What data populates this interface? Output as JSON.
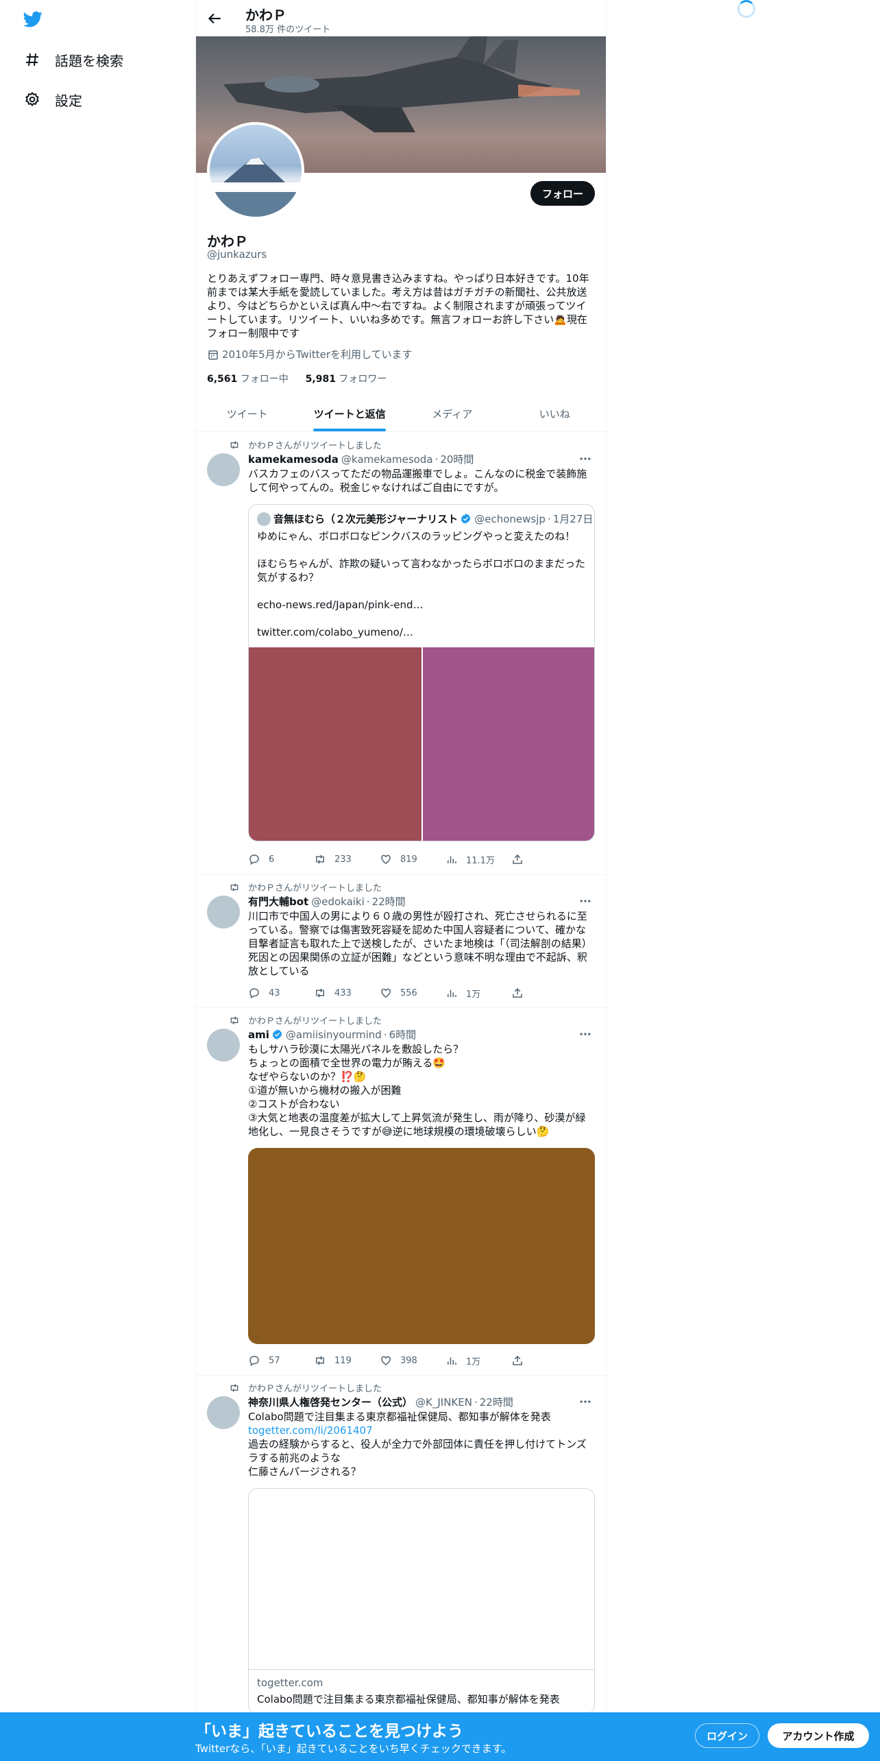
{
  "colors": {
    "accent": "#1d9bf0",
    "text": "#0f1419",
    "secondary": "#536471",
    "verified": "#1d9bf0"
  },
  "nav": {
    "logo_icon": "twitter-bird-icon",
    "explore_label": "話題を検索",
    "settings_label": "設定"
  },
  "header": {
    "title": "かわＰ",
    "subtitle": "58.8万 件のツイート"
  },
  "profile": {
    "name": "かわＰ",
    "handle": "@junkazurs",
    "follow_label": "フォロー",
    "bio": "とりあえずフォロー専門、時々意見書き込みますね。やっぱり日本好きです。10年前までは某大手紙を愛読していました。考え方は昔はガチガチの新聞社、公共放送より、今はどちらかといえば真ん中～右ですね。よく制限されますが頑張ってツイートしています。リツイート、いいね多めです。無言フォローお許し下さい🙇現在フォロー制限中です",
    "joined": "2010年5月からTwitterを利用しています",
    "following_count": "6,561",
    "following_label": "フォロー中",
    "followers_count": "5,981",
    "followers_label": "フォロワー"
  },
  "tabs": [
    {
      "label": "ツイート"
    },
    {
      "label": "ツイートと返信"
    },
    {
      "label": "メディア"
    },
    {
      "label": "いいね"
    }
  ],
  "tweets": [
    {
      "retweet_label": "かわＰさんがリツイートしました",
      "name": "kamekamesoda",
      "handle": "@kamekamesoda",
      "time": "20時間",
      "text": "バスカフェのバスってただの物品運搬車でしょ。こんなのに税金で装飾施して何やってんの。税金じゃなければご自由にですが。",
      "quote": {
        "name": "音無ほむら（２次元美形ジャーナリスト",
        "handle": "@echonewsjp",
        "time": "1月27日",
        "line1": "ゆめにゃん、ボロボロなピンクバスのラッピングやっと変えたのね！",
        "line2": "ほむらちゃんが、詐欺の疑いって言わなかったらボロボロのままだった気がするわ？",
        "line3": "echo-news.red/Japan/pink-end…",
        "line4": "twitter.com/colabo_yumeno/…"
      },
      "replies": "6",
      "retweets": "233",
      "likes": "819",
      "views": "11.1万"
    },
    {
      "retweet_label": "かわＰさんがリツイートしました",
      "name": "有門大輔bot",
      "handle": "@edokaiki",
      "time": "22時間",
      "text": "川口市で中国人の男により６０歳の男性が殴打され、死亡させられるに至っている。警察では傷害致死容疑を認めた中国人容疑者について、確かな目撃者証言も取れた上で送検したが、さいたま地検は「（司法解剖の結果）死因との因果関係の立証が困難」などという意味不明な理由で不起訴、釈放としている",
      "replies": "43",
      "retweets": "433",
      "likes": "556",
      "views": "1万"
    },
    {
      "retweet_label": "かわＰさんがリツイートしました",
      "name": "ami",
      "handle": "@amiisinyourmind",
      "time": "6時間",
      "lines": [
        "もしサハラ砂漠に太陽光パネルを敷設したら？",
        "ちょっとの面積で全世界の電力が賄える🤩",
        "なぜやらないのか？⁉️🤔",
        "①道が無いから機材の搬入が困難",
        "②コストが合わない",
        "③大気と地表の温度差が拡大して上昇気流が発生し、雨が降り、砂漠が緑地化し、一見良さそうですが😅逆に地球規模の環境破壊らしい🤔"
      ],
      "media_color": "#8b5a1f",
      "replies": "57",
      "retweets": "119",
      "likes": "398",
      "views": "1万"
    },
    {
      "retweet_label": "かわＰさんがリツイートしました",
      "name": "神奈川県人権啓発センター（公式）",
      "handle": "@K_JINKEN",
      "time": "22時間",
      "line1": "Colabo問題で注目集まる東京都福祉保健局、都知事が解体を発表",
      "link": "togetter.com/li/2061407",
      "line2": "過去の経験からすると、役人が全力で外部団体に責任を押し付けてトンズラする前兆のような",
      "line3": "仁藤さんパージされる？",
      "card_domain": "togetter.com",
      "card_title": "Colabo問題で注目集まる東京都福祉保健局、都知事が解体を発表"
    }
  ],
  "bottom": {
    "title": "「いま」起きていることを見つけよう",
    "subtitle": "Twitterなら、「いま」起きていることをいち早くチェックできます。",
    "login_label": "ログイン",
    "signup_label": "アカウント作成"
  }
}
